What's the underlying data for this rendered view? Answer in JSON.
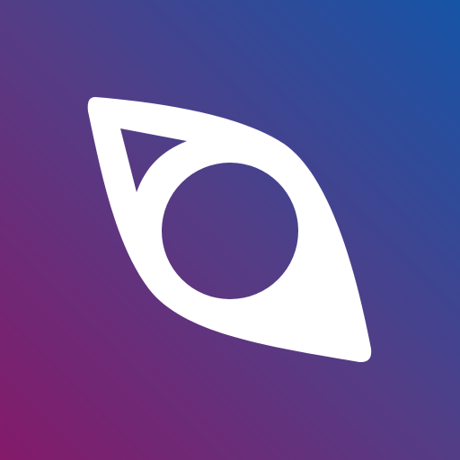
{
  "icon": {
    "name": "eye-logo-icon",
    "colors": {
      "gradient_top_right": "#1654A6",
      "gradient_middle": "#533D86",
      "gradient_bottom_left": "#841A69",
      "foreground": "#FFFFFF"
    }
  }
}
